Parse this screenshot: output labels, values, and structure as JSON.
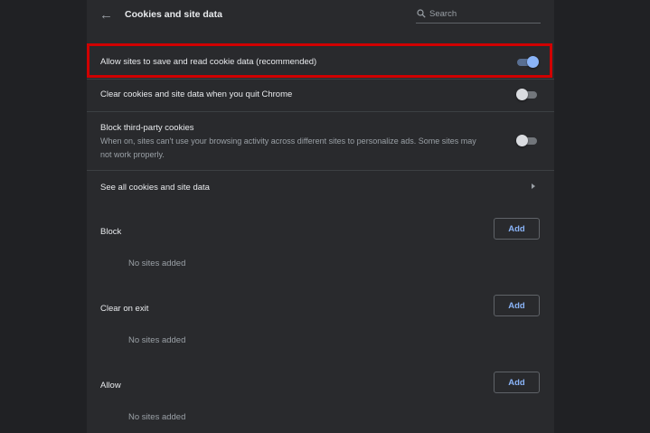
{
  "header": {
    "title": "Cookies and site data",
    "back_icon": "←",
    "search_placeholder": "Search"
  },
  "settings": {
    "allow_label": "Allow sites to save and read cookie data (recommended)",
    "allow_enabled": true,
    "clear_on_quit_label": "Clear cookies and site data when you quit Chrome",
    "clear_on_quit_enabled": false,
    "block_third_party_label": "Block third-party cookies",
    "block_third_party_desc": "When on, sites can't use your browsing activity across different sites to personalize ads. Some sites may not work properly.",
    "block_third_party_enabled": false,
    "see_all_label": "See all cookies and site data"
  },
  "sections": {
    "block": {
      "title": "Block",
      "add_label": "Add",
      "empty_text": "No sites added"
    },
    "clear_on_exit": {
      "title": "Clear on exit",
      "add_label": "Add",
      "empty_text": "No sites added"
    },
    "allow": {
      "title": "Allow",
      "add_label": "Add",
      "empty_text": "No sites added"
    }
  },
  "colors": {
    "accent": "#8ab4f8",
    "highlight_border": "#d00000",
    "panel_bg": "#292a2d",
    "page_bg": "#202124"
  }
}
